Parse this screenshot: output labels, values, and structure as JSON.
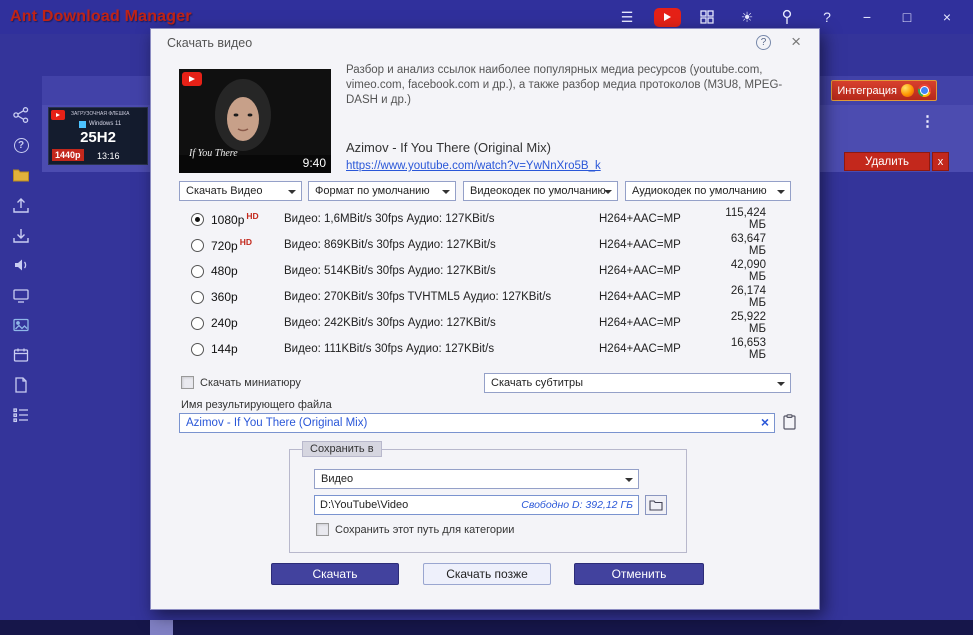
{
  "window": {
    "title": "Ant Download Manager"
  },
  "glyphs": {
    "menu": "☰",
    "sun": "☀",
    "help": "?",
    "minimize": "−",
    "maximize": "□",
    "close": "×",
    "kebab": "⋮",
    "close_lower": "x"
  },
  "background": {
    "integration_label": "Интеграция",
    "delete_label": "Удалить",
    "close_item_label": "x",
    "thumb": {
      "line1": "ЗАГРУЗОЧНАЯ ФЛЕШКА",
      "line2": "Windows 11",
      "title": "25H2",
      "quality": "1440p",
      "duration": "13:16"
    }
  },
  "dialog": {
    "title": "Скачать видео",
    "description": "Разбор и анализ ссылок наиболее популярных медиа ресурсов (youtube.com, vimeo.com, facebook.com и др.), а также разбор медиа протоколов (M3U8, MPEG-DASH и др.)",
    "video": {
      "title": "Azimov - If You There (Original Mix)",
      "url": "https://www.youtube.com/watch?v=YwNnXro5B_k",
      "duration": "9:40",
      "overlay_text": "If You There"
    },
    "dropdowns": {
      "action": "Скачать Видео",
      "format": "Формат по умолчанию",
      "vcodec": "Видеокодек по умолчанию",
      "acodec": "Аудиокодек по умолчанию"
    },
    "qualities": [
      {
        "label": "1080p",
        "hd": "HD",
        "details": "Видео: 1,6MBit/s 30fps Аудио: 127KBit/s",
        "codec": "H264+AAC=MP",
        "size": "115,424 МБ",
        "selected": true
      },
      {
        "label": "720p",
        "hd": "HD",
        "details": "Видео: 869KBit/s 30fps Аудио: 127KBit/s",
        "codec": "H264+AAC=MP",
        "size": "63,647 МБ",
        "selected": false
      },
      {
        "label": "480p",
        "details": "Видео: 514KBit/s 30fps Аудио: 127KBit/s",
        "codec": "H264+AAC=MP",
        "size": "42,090 МБ",
        "selected": false
      },
      {
        "label": "360p",
        "details": "Видео: 270KBit/s 30fps TVHTML5 Аудио: 127KBit/s",
        "codec": "H264+AAC=MP",
        "size": "26,174 МБ",
        "selected": false
      },
      {
        "label": "240p",
        "details": "Видео: 242KBit/s 30fps Аудио: 127KBit/s",
        "codec": "H264+AAC=MP",
        "size": "25,922 МБ",
        "selected": false
      },
      {
        "label": "144p",
        "details": "Видео: 111KBit/s 30fps Аудио: 127KBit/s",
        "codec": "H264+AAC=MP",
        "size": "16,653 МБ",
        "selected": false
      }
    ],
    "thumbnail_checkbox": "Скачать миниатюру",
    "subtitles_dropdown": "Скачать субтитры",
    "filename_label": "Имя результирующего файла",
    "filename_value": "Azimov - If You There (Original Mix)",
    "save_group": {
      "legend": "Сохранить в",
      "category": "Видео",
      "path": "D:\\YouTube\\Video",
      "free_space": "Свободно D: 392,12 ГБ",
      "save_path_checkbox": "Сохранить этот путь для категории"
    },
    "buttons": {
      "download": "Скачать",
      "download_later": "Скачать позже",
      "cancel": "Отменить"
    }
  }
}
